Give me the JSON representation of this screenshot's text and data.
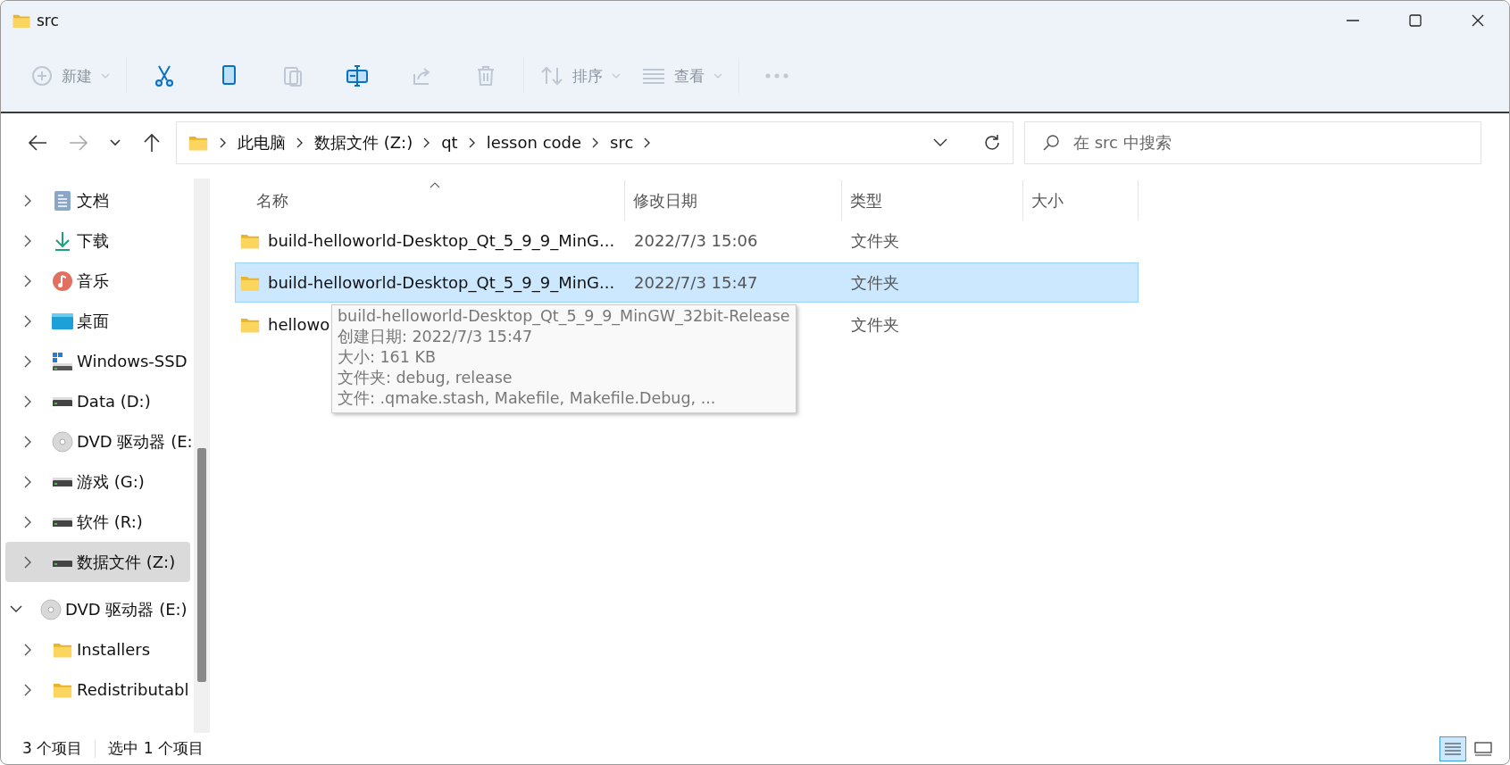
{
  "window": {
    "title": "src"
  },
  "toolbar": [
    {
      "kind": "new",
      "label": "新建",
      "disabled": true
    },
    {
      "kind": "cut",
      "disabled": false
    },
    {
      "kind": "copy",
      "disabled": false
    },
    {
      "kind": "paste",
      "disabled": true
    },
    {
      "kind": "rename",
      "disabled": false
    },
    {
      "kind": "share",
      "disabled": true
    },
    {
      "kind": "delete",
      "disabled": true
    },
    {
      "kind": "sort",
      "label": "排序",
      "disabled": true
    },
    {
      "kind": "view",
      "label": "查看",
      "disabled": true
    },
    {
      "kind": "more",
      "disabled": true
    }
  ],
  "nav": [
    {
      "kind": "back",
      "disabled": false
    },
    {
      "kind": "forward",
      "disabled": true
    },
    {
      "kind": "recent",
      "disabled": false
    },
    {
      "kind": "up",
      "disabled": false
    }
  ],
  "address": {
    "crumbs": [
      "此电脑",
      "数据文件 (Z:)",
      "qt",
      "lesson code",
      "src"
    ]
  },
  "search": {
    "placeholder": "在 src 中搜索"
  },
  "sidebar": {
    "items": [
      {
        "label": "文档",
        "kind": "documents",
        "expanded": false,
        "selected": false
      },
      {
        "label": "下载",
        "kind": "downloads",
        "expanded": false,
        "selected": false
      },
      {
        "label": "音乐",
        "kind": "music",
        "expanded": false,
        "selected": false
      },
      {
        "label": "桌面",
        "kind": "desktop",
        "expanded": false,
        "selected": false
      },
      {
        "label": "Windows-SSD",
        "kind": "system-drive",
        "expanded": false,
        "selected": false
      },
      {
        "label": "Data (D:)",
        "kind": "drive",
        "expanded": false,
        "selected": false
      },
      {
        "label": "DVD 驱动器 (E:",
        "kind": "disc",
        "expanded": false,
        "selected": false
      },
      {
        "label": "游戏 (G:)",
        "kind": "drive",
        "expanded": false,
        "selected": false
      },
      {
        "label": "软件 (R:)",
        "kind": "drive",
        "expanded": false,
        "selected": false
      },
      {
        "label": "数据文件 (Z:)",
        "kind": "drive",
        "expanded": false,
        "selected": true
      },
      {
        "label": "DVD 驱动器 (E:)",
        "kind": "disc",
        "expanded": true,
        "selected": false,
        "children": [
          {
            "label": "Installers",
            "kind": "folder",
            "expanded": false,
            "selected": false
          },
          {
            "label": "Redistributabl",
            "kind": "folder",
            "expanded": false,
            "selected": false
          }
        ]
      }
    ]
  },
  "files": {
    "columns": [
      {
        "label": "名称",
        "sorted": true
      },
      {
        "label": "修改日期",
        "sorted": false
      },
      {
        "label": "类型",
        "sorted": false
      },
      {
        "label": "大小",
        "sorted": false
      }
    ],
    "rows": [
      {
        "name": "build-helloworld-Desktop_Qt_5_9_9_MinG...",
        "modified": "2022/7/3 15:06",
        "type": "文件夹",
        "selected": false
      },
      {
        "name": "build-helloworld-Desktop_Qt_5_9_9_MinG...",
        "modified": "2022/7/3 15:47",
        "type": "文件夹",
        "selected": true
      },
      {
        "name": "hellowo",
        "type": "文件夹",
        "selected": false
      }
    ],
    "tooltip": {
      "lines": [
        "build-helloworld-Desktop_Qt_5_9_9_MinGW_32bit-Release",
        "创建日期: 2022/7/3 15:47",
        "大小: 161 KB",
        "文件夹: debug, release",
        "文件: .qmake.stash, Makefile, Makefile.Debug, ..."
      ]
    }
  },
  "status_bar": {
    "count": "3 个项目",
    "selection": "选中 1 个项目",
    "views": [
      {
        "kind": "details",
        "selected": true
      },
      {
        "kind": "tiles",
        "selected": false
      }
    ]
  }
}
